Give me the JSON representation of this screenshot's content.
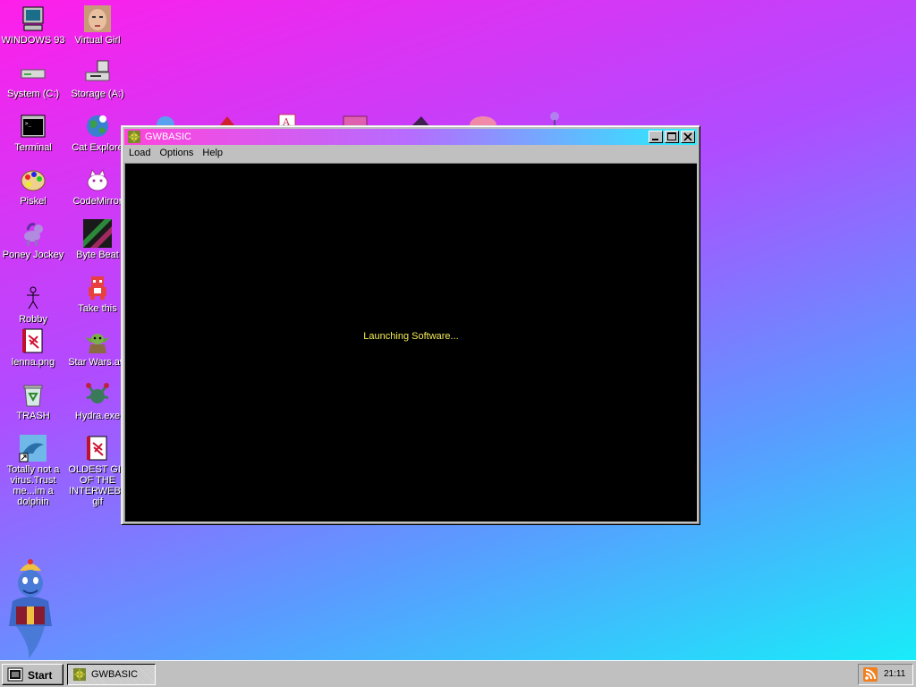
{
  "desktop": {
    "icons": [
      {
        "label": "WINDOWS 93",
        "icon": "computer-icon"
      },
      {
        "label": "Virtual Girl",
        "icon": "face-icon"
      },
      {
        "label": "System (C:)",
        "icon": "drive-icon"
      },
      {
        "label": "Storage (A:)",
        "icon": "floppy-drive-icon"
      },
      {
        "label": "Terminal",
        "icon": "terminal-icon"
      },
      {
        "label": "Cat Explore",
        "icon": "globe-icon"
      },
      {
        "label": "Piskel",
        "icon": "palette-icon"
      },
      {
        "label": "CodeMirror",
        "icon": "cat-icon"
      },
      {
        "label": "Poney Jockey",
        "icon": "pony-icon"
      },
      {
        "label": "Byte Beat",
        "icon": "bytebeat-icon"
      },
      {
        "label": "Robby",
        "icon": "stickman-icon"
      },
      {
        "label": "Take this",
        "icon": "pixel-creature-icon"
      },
      {
        "label": "lenna.png",
        "icon": "image-file-icon"
      },
      {
        "label": "Star Wars.avi",
        "icon": "yoda-icon"
      },
      {
        "label": "TRASH",
        "icon": "trash-icon"
      },
      {
        "label": "Hydra.exe",
        "icon": "hydra-icon"
      },
      {
        "label": "Totally not a virus.Trust me...im a dolphin",
        "icon": "dolphin-icon"
      },
      {
        "label": "OLDEST GIF OF THE INTERWEB3 gif",
        "icon": "gif-file-icon"
      }
    ]
  },
  "window": {
    "title": "GWBASIC",
    "menu": [
      "Load",
      "Options",
      "Help"
    ],
    "status": "Launching Software..."
  },
  "taskbar": {
    "start_label": "Start",
    "task_label": "GWBASIC",
    "clock": "21:11"
  },
  "colors": {
    "title_gradient_start": "#ff44dd",
    "title_gradient_end": "#25f0ff",
    "terminal_text": "#f3ec57"
  }
}
